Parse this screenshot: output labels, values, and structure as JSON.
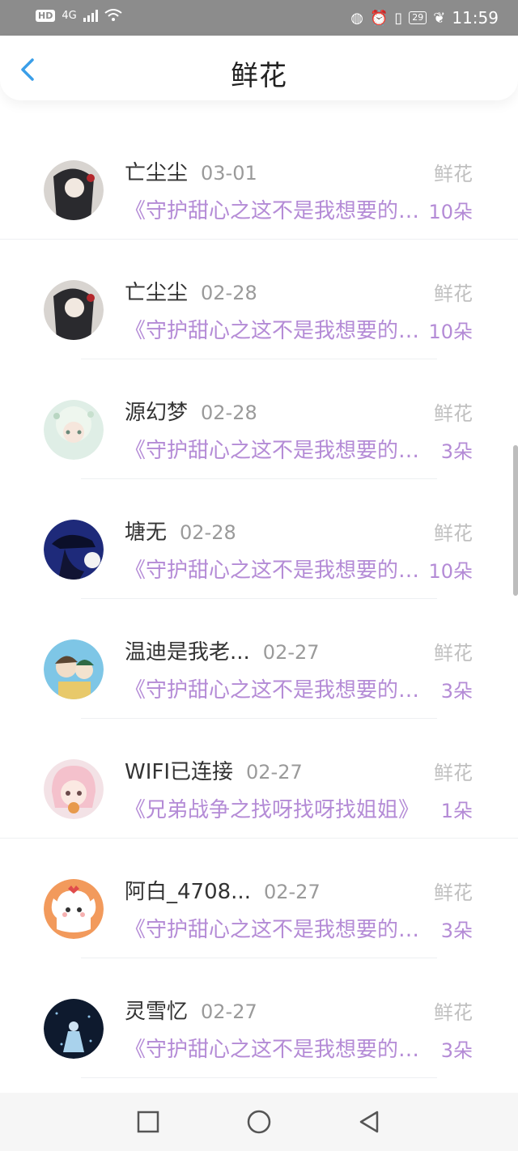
{
  "status": {
    "left": "4G",
    "battery": "29",
    "time": "11:59"
  },
  "header": {
    "title": "鲜花"
  },
  "items": [
    {
      "name": "亡尘尘",
      "date": "03-01",
      "tag": "鲜花",
      "book": "《守护甜心之这不是我想要的结局》",
      "count": "10朵"
    },
    {
      "name": "亡尘尘",
      "date": "02-28",
      "tag": "鲜花",
      "book": "《守护甜心之这不是我想要的结局》",
      "count": "10朵"
    },
    {
      "name": "源幻梦",
      "date": "02-28",
      "tag": "鲜花",
      "book": "《守护甜心之这不是我想要的结局》",
      "count": "3朵"
    },
    {
      "name": "塘无",
      "date": "02-28",
      "tag": "鲜花",
      "book": "《守护甜心之这不是我想要的结局》",
      "count": "10朵"
    },
    {
      "name": "温迪是我老...",
      "date": "02-27",
      "tag": "鲜花",
      "book": "《守护甜心之这不是我想要的结局》",
      "count": "3朵"
    },
    {
      "name": "WIFI已连接",
      "date": "02-27",
      "tag": "鲜花",
      "book": "《兄弟战争之找呀找呀找姐姐》",
      "count": "1朵"
    },
    {
      "name": "阿白_4708...",
      "date": "02-27",
      "tag": "鲜花",
      "book": "《守护甜心之这不是我想要的结局》",
      "count": "3朵"
    },
    {
      "name": "灵雪忆",
      "date": "02-27",
      "tag": "鲜花",
      "book": "《守护甜心之这不是我想要的结局》",
      "count": "3朵"
    }
  ],
  "colors": {
    "accent": "#3a9ee8",
    "book": "#b48bd6"
  }
}
